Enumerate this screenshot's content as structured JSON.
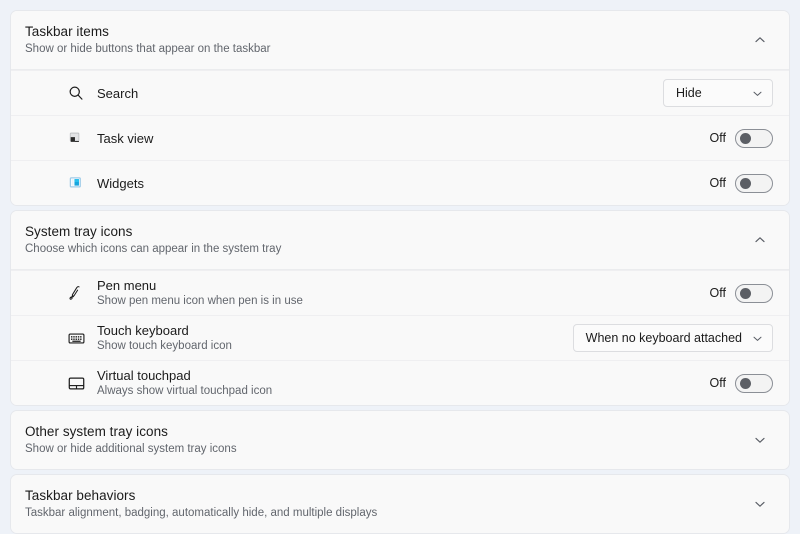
{
  "sections": [
    {
      "id": "taskbar-items",
      "title": "Taskbar items",
      "subtitle": "Show or hide buttons that appear on the taskbar",
      "expanded": true,
      "chevron": "chevron-up-icon",
      "rows": [
        {
          "id": "search",
          "icon": "search-icon",
          "label": "Search",
          "sub": "",
          "control": "dropdown",
          "value": "Hide"
        },
        {
          "id": "task-view",
          "icon": "task-view-icon",
          "label": "Task view",
          "sub": "",
          "control": "toggle",
          "state": "Off",
          "on": false
        },
        {
          "id": "widgets",
          "icon": "widgets-icon",
          "label": "Widgets",
          "sub": "",
          "control": "toggle",
          "state": "Off",
          "on": false
        }
      ]
    },
    {
      "id": "system-tray-icons",
      "title": "System tray icons",
      "subtitle": "Choose which icons can appear in the system tray",
      "expanded": true,
      "chevron": "chevron-up-icon",
      "rows": [
        {
          "id": "pen-menu",
          "icon": "pen-icon",
          "label": "Pen menu",
          "sub": "Show pen menu icon when pen is in use",
          "control": "toggle",
          "state": "Off",
          "on": false
        },
        {
          "id": "touch-keyboard",
          "icon": "keyboard-icon",
          "label": "Touch keyboard",
          "sub": "Show touch keyboard icon",
          "control": "dropdown",
          "value": "When no keyboard attached"
        },
        {
          "id": "virtual-touchpad",
          "icon": "touchpad-icon",
          "label": "Virtual touchpad",
          "sub": "Always show virtual touchpad icon",
          "control": "toggle",
          "state": "Off",
          "on": false
        }
      ]
    },
    {
      "id": "other-system-tray-icons",
      "title": "Other system tray icons",
      "subtitle": "Show or hide additional system tray icons",
      "expanded": false,
      "chevron": "chevron-down-icon",
      "rows": []
    },
    {
      "id": "taskbar-behaviors",
      "title": "Taskbar behaviors",
      "subtitle": "Taskbar alignment, badging, automatically hide, and multiple displays",
      "expanded": false,
      "chevron": "chevron-down-icon",
      "rows": []
    }
  ],
  "colors": {
    "page_background": "#eef2f8",
    "card_background": "#f9f9f9",
    "title_text": "#1b1b1b",
    "subtitle_text": "#62666d",
    "widgets_accent": "#0f8fd8",
    "divider": "#efeff1"
  }
}
